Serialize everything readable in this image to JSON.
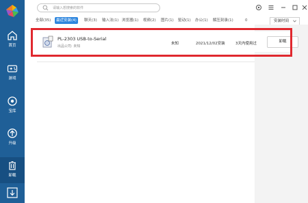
{
  "search": {
    "placeholder": "请输入想搜索的软件"
  },
  "sidebar": {
    "items": [
      {
        "label": "首页",
        "icon": "home-icon"
      },
      {
        "label": "游戏",
        "icon": "gamepad-icon"
      },
      {
        "label": "宝库",
        "icon": "treasure-icon"
      },
      {
        "label": "升级",
        "icon": "upgrade-icon"
      },
      {
        "label": "卸载",
        "icon": "trash-icon"
      }
    ]
  },
  "tabs": [
    {
      "label": "全部(35)"
    },
    {
      "label": "最近安装(4)"
    },
    {
      "label": "聊天(3)"
    },
    {
      "label": "输入法(1)"
    },
    {
      "label": "浏览器(1)"
    },
    {
      "label": "视频(2)"
    },
    {
      "label": "图片(1)"
    },
    {
      "label": "驱动(1)"
    },
    {
      "label": "办公(1)"
    },
    {
      "label": "解压刻录(1)"
    },
    {
      "label": "0"
    }
  ],
  "sort": {
    "label": "安装时间"
  },
  "app": {
    "name": "PL-2303 USB-to-Serial",
    "publisher": "出品公司: 未知",
    "size": "未知",
    "install_date": "2021/12/02安装",
    "usage": "3天内使用过",
    "action": "卸载"
  },
  "colors": {
    "sidebar": "#1f5f97",
    "accent": "#2e86de",
    "highlight": "#e0282e"
  }
}
